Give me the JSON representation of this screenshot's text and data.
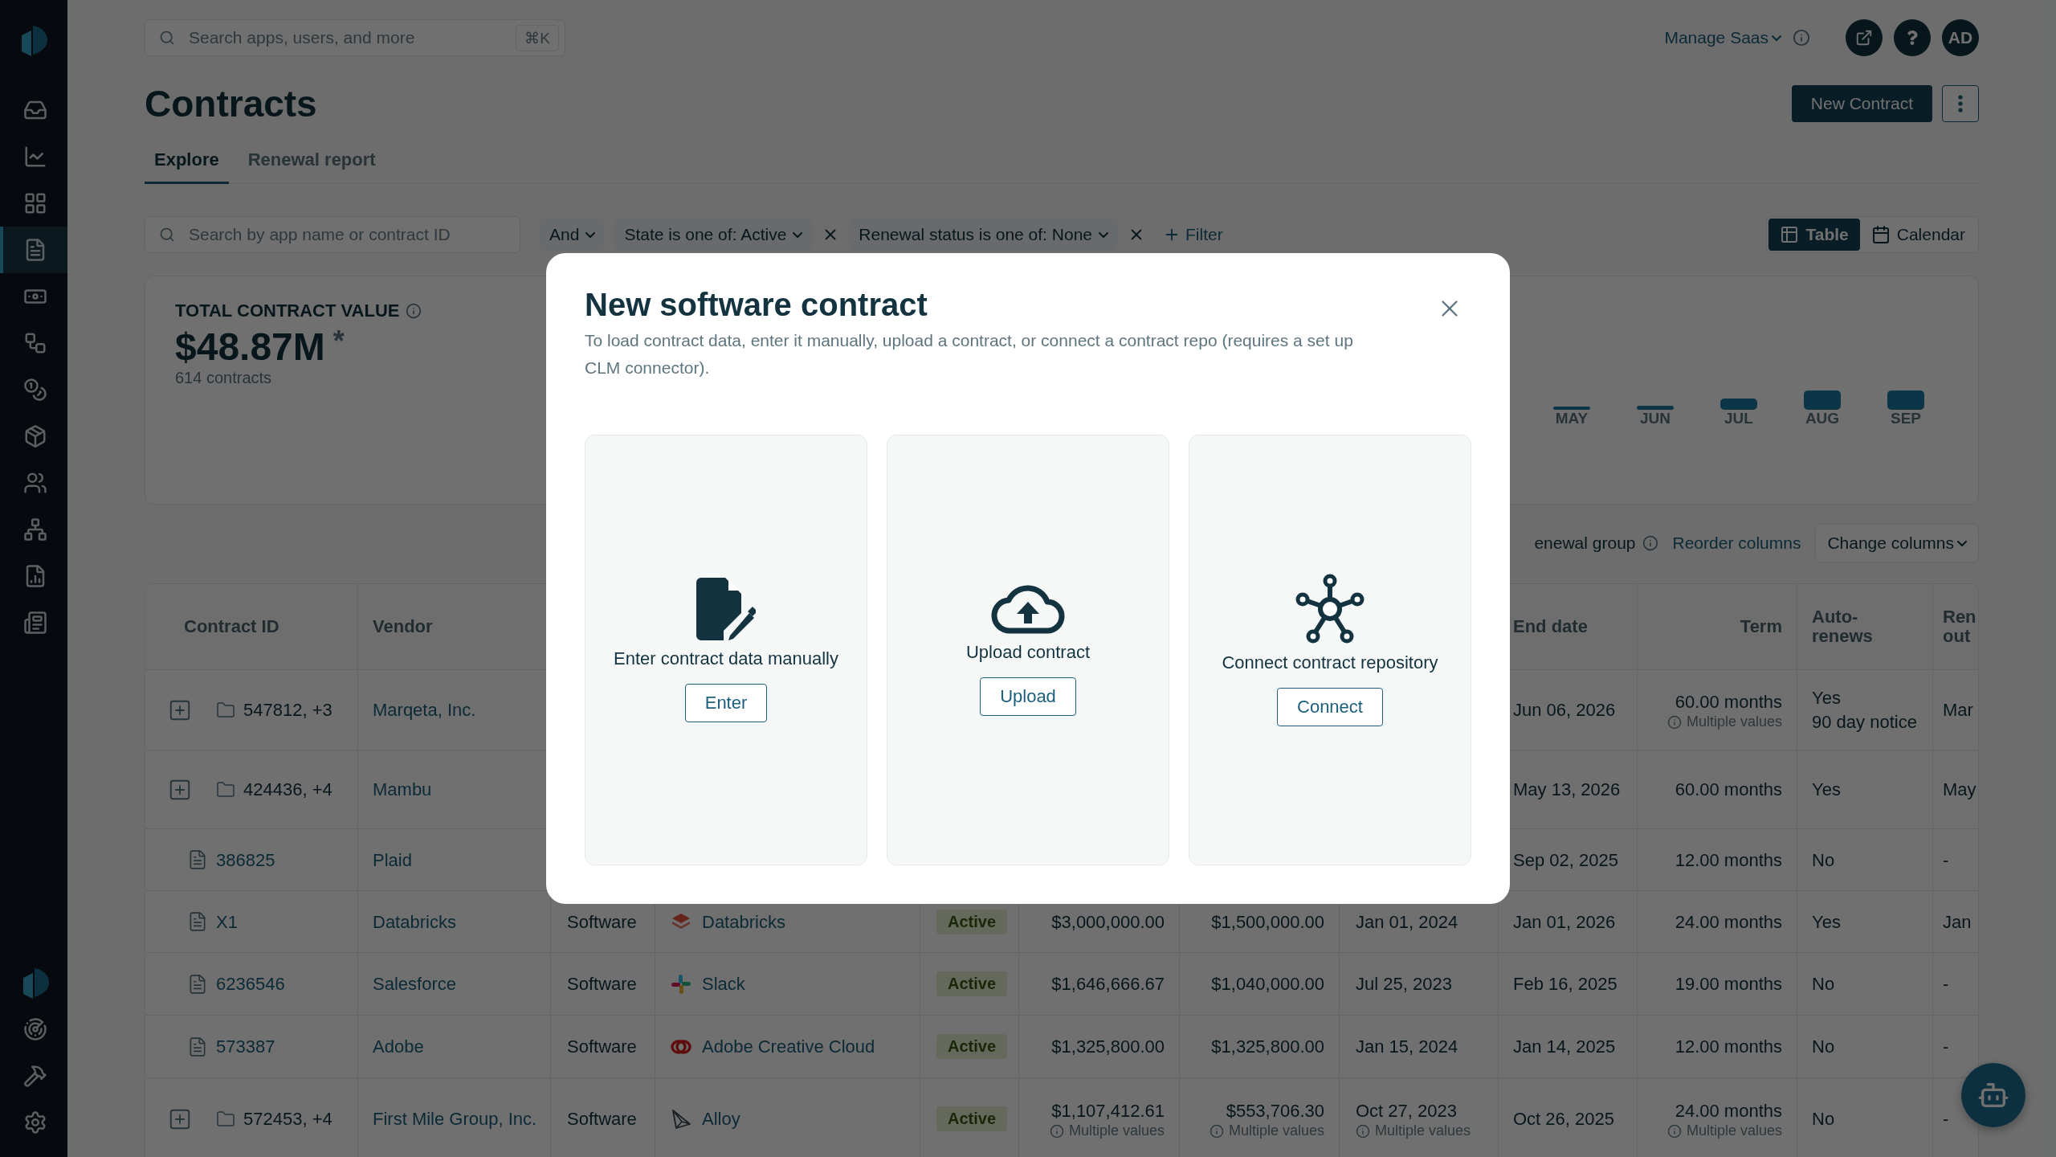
{
  "sidebar": {
    "items": [
      {
        "selected": false
      },
      {
        "selected": false
      },
      {
        "selected": false
      },
      {
        "selected": true
      },
      {
        "selected": false
      },
      {
        "selected": false
      },
      {
        "selected": false
      },
      {
        "selected": false
      },
      {
        "selected": false
      },
      {
        "selected": false
      },
      {
        "selected": false
      },
      {
        "selected": false
      }
    ]
  },
  "header": {
    "search": {
      "placeholder": "Search apps, users, and more",
      "shortcut": "⌘K"
    },
    "workspace": "Manage Saas",
    "avatar": "AD"
  },
  "page": {
    "title": "Contracts",
    "primary_action": "New Contract"
  },
  "tabs": [
    {
      "label": "Explore",
      "selected": true
    },
    {
      "label": "Renewal report",
      "selected": false
    }
  ],
  "filters": {
    "search": {
      "placeholder": "Search by app name or contract ID"
    },
    "conjunction": "And",
    "chips": [
      {
        "label": "State is one of: Active"
      },
      {
        "label": "Renewal status is one of: None"
      }
    ],
    "add": "Filter"
  },
  "views": [
    {
      "label": "Table",
      "selected": true
    },
    {
      "label": "Calendar",
      "selected": false
    }
  ],
  "summary": {
    "label": "TOTAL CONTRACT VALUE",
    "value": "$48.87M",
    "value_mark": "*",
    "count": "614 contracts",
    "months": [
      "MAY",
      "JUN",
      "JUL",
      "AUG",
      "SEP"
    ]
  },
  "column_tools": {
    "group_label": "enewal group",
    "reorder": "Reorder columns",
    "change": "Change columns"
  },
  "table": {
    "header": {
      "contract_id": "Contract ID",
      "vendor": "Vendor",
      "end_date": "End date",
      "term": "Term",
      "auto_renews": "Auto-renews",
      "column_12": "Ren out"
    },
    "rows": [
      {
        "contract_id": {
          "kind": "group",
          "text": "547812, +3"
        },
        "vendor": "Marqeta, Inc.",
        "end_date": "Jun 06, 2026",
        "term": {
          "text": "60.00 months",
          "note": "Multiple values"
        },
        "auto_renews": {
          "text": "Yes",
          "sub": "90 day notice"
        },
        "column_12": "Mar"
      },
      {
        "contract_id": {
          "kind": "group",
          "text": "424436, +4"
        },
        "vendor": "Mambu",
        "end_date": "May 13, 2026",
        "term": "60.00 months",
        "auto_renews": "Yes",
        "column_12": "May"
      },
      {
        "contract_id": {
          "kind": "doc",
          "text": "386825"
        },
        "vendor": "Plaid",
        "end_date": "Sep 02, 2025",
        "term": "12.00 months",
        "auto_renews": "No",
        "column_12": "-"
      },
      {
        "contract_id": {
          "kind": "doc",
          "text": "X1"
        },
        "vendor": "Databricks",
        "column_3": "Software",
        "column_4": {
          "kind": "layers",
          "text": "Databricks"
        },
        "column_5": "Active",
        "column_6": "$3,000,000.00",
        "column_7": "$1,500,000.00",
        "column_8": "Jan 01, 2024",
        "end_date": "Jan 01, 2026",
        "term": "24.00 months",
        "auto_renews": "Yes",
        "column_12": "Jan"
      },
      {
        "contract_id": {
          "kind": "doc",
          "text": "6236546"
        },
        "vendor": "Salesforce",
        "column_3": "Software",
        "column_4": {
          "kind": "pinwheel",
          "text": "Slack"
        },
        "column_5": "Active",
        "column_6": "$1,646,666.67",
        "column_7": "$1,040,000.00",
        "column_8": "Jul 25, 2023",
        "end_date": "Feb 16, 2025",
        "term": "19.00 months",
        "auto_renews": "No",
        "column_12": "-"
      },
      {
        "contract_id": {
          "kind": "doc",
          "text": "573387"
        },
        "vendor": "Adobe",
        "column_3": "Software",
        "column_4": {
          "kind": "rings",
          "text": "Adobe Creative Cloud"
        },
        "column_5": "Active",
        "column_6": "$1,325,800.00",
        "column_7": "$1,325,800.00",
        "column_8": "Jan 15, 2024",
        "end_date": "Jan 14, 2025",
        "term": "12.00 months",
        "auto_renews": "No",
        "column_12": "-"
      },
      {
        "contract_id": {
          "kind": "group",
          "text": "572453, +4"
        },
        "vendor": "First Mile Group, Inc.",
        "column_3": "Software",
        "column_4": {
          "kind": "prism",
          "text": "Alloy"
        },
        "column_5": "Active",
        "column_6": {
          "text": "$1,107,412.61",
          "note": "Multiple values"
        },
        "column_7": {
          "text": "$553,706.30",
          "note": "Multiple values"
        },
        "column_8": {
          "text": "Oct 27, 2023",
          "note": "Multiple values"
        },
        "end_date": "Oct 26, 2025",
        "term": {
          "text": "24.00 months",
          "note": "Multiple values"
        },
        "auto_renews": "No",
        "column_12": "-"
      }
    ]
  },
  "modal": {
    "title": "New software contract",
    "description": "To load contract data, enter it manually, upload a contract, or connect a contract repo (requires a set up CLM connector).",
    "options": [
      {
        "kind": "edit",
        "label": "Enter contract data manually",
        "button": "Enter"
      },
      {
        "kind": "upload",
        "label": "Upload contract",
        "button": "Upload"
      },
      {
        "kind": "network",
        "label": "Connect contract repository",
        "button": "Connect"
      }
    ]
  }
}
